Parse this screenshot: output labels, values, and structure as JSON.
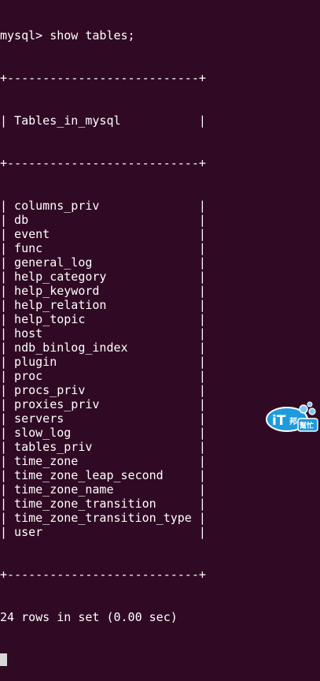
{
  "terminal": {
    "prompt": "mysql> show tables;",
    "border": "+---------------------------+",
    "header": "| Tables_in_mysql           |",
    "rows": [
      "| columns_priv              |",
      "| db                        |",
      "| event                     |",
      "| func                      |",
      "| general_log               |",
      "| help_category             |",
      "| help_keyword              |",
      "| help_relation             |",
      "| help_topic                |",
      "| host                      |",
      "| ndb_binlog_index          |",
      "| plugin                    |",
      "| proc                      |",
      "| procs_priv                |",
      "| proxies_priv              |",
      "| servers                   |",
      "| slow_log                  |",
      "| tables_priv               |",
      "| time_zone                 |",
      "| time_zone_leap_second     |",
      "| time_zone_name            |",
      "| time_zone_transition      |",
      "| time_zone_transition_type |",
      "| user                      |"
    ],
    "status": "24 rows in set (0.00 sec)",
    "background_color": "#300a24",
    "text_color": "#ffffff"
  },
  "watermark": {
    "logo_text": "iT邦幫忙",
    "icon": "ithome-logo-icon"
  }
}
